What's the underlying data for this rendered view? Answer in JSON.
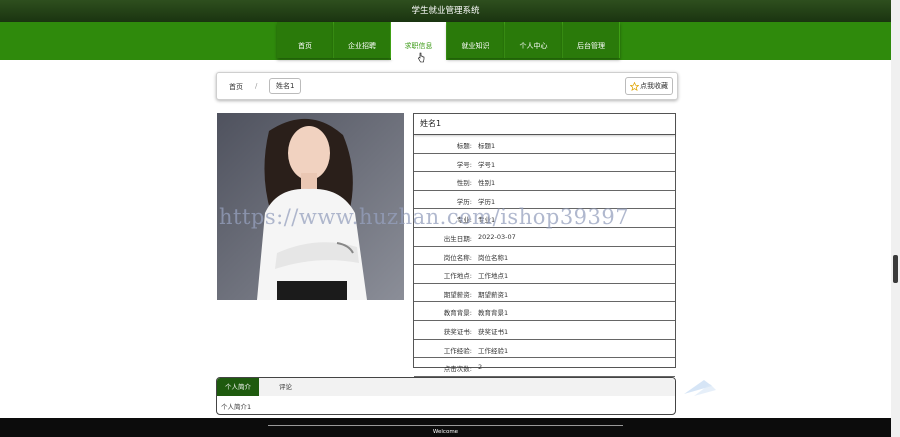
{
  "app": {
    "title": "学生就业管理系统"
  },
  "nav": {
    "items": [
      {
        "label": "首页"
      },
      {
        "label": "企业招聘"
      },
      {
        "label": "求职信息"
      },
      {
        "label": "就业知识"
      },
      {
        "label": "个人中心"
      },
      {
        "label": "后台管理"
      }
    ],
    "active": "求职信息"
  },
  "breadcrumb": {
    "home": "首页",
    "separator": "/",
    "current": "姓名1"
  },
  "favorite": {
    "label": "点我收藏",
    "icon": "star-icon"
  },
  "detail": {
    "title": "姓名1",
    "rows": [
      {
        "label": "标题:",
        "value": "标题1"
      },
      {
        "label": "学号:",
        "value": "学号1"
      },
      {
        "label": "性别:",
        "value": "性别1"
      },
      {
        "label": "学历:",
        "value": "学历1"
      },
      {
        "label": "专业:",
        "value": "专业1"
      },
      {
        "label": "出生日期:",
        "value": "2022-03-07"
      },
      {
        "label": "岗位名称:",
        "value": "岗位名称1"
      },
      {
        "label": "工作地点:",
        "value": "工作地点1"
      },
      {
        "label": "期望薪资:",
        "value": "期望薪资1"
      },
      {
        "label": "教育背景:",
        "value": "教育背景1"
      },
      {
        "label": "获奖证书:",
        "value": "获奖证书1"
      },
      {
        "label": "工作经验:",
        "value": "工作经验1"
      },
      {
        "label": "点击次数:",
        "value": "2"
      }
    ]
  },
  "watermark": "https://www.huzhan.com/ishop39397",
  "tabs": {
    "items": [
      {
        "label": "个人简介"
      },
      {
        "label": "评论"
      }
    ],
    "content": "个人简介1"
  },
  "footer": {
    "text": "Welcome"
  },
  "colors": {
    "nav_green": "#2f8a0c",
    "header_dark": "#1a3410",
    "active_tab": "#1e5a0e"
  }
}
